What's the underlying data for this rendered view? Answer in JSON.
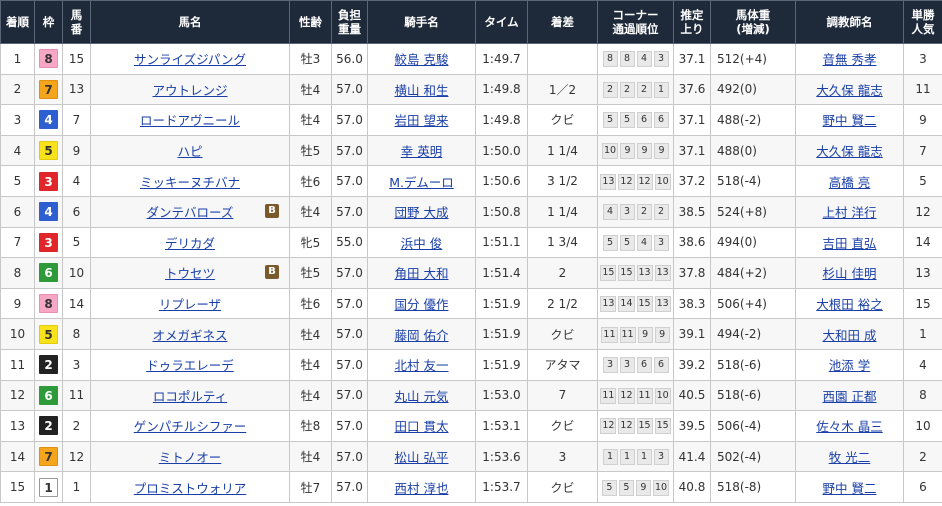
{
  "headers": {
    "rank": "着順",
    "waku": "枠",
    "umaban": [
      "馬",
      "番"
    ],
    "horse": "馬名",
    "sexage": "性齢",
    "weight": [
      "負担",
      "重量"
    ],
    "jockey": "騎手名",
    "time": "タイム",
    "margin": "着差",
    "corner": [
      "コーナー",
      "通過順位"
    ],
    "last": [
      "推定",
      "上り"
    ],
    "bodyweight": [
      "馬体重",
      "(増減)"
    ],
    "trainer": "調教師名",
    "pop": [
      "単勝",
      "人気"
    ]
  },
  "waku_colors": {
    "1": {
      "bg": "#ffffff",
      "fg": "#333333",
      "border": "#999999"
    },
    "2": {
      "bg": "#222222",
      "fg": "#ffffff",
      "border": "#222222"
    },
    "3": {
      "bg": "#e0262a",
      "fg": "#ffffff",
      "border": "#e0262a"
    },
    "4": {
      "bg": "#2e5fd1",
      "fg": "#ffffff",
      "border": "#2e5fd1"
    },
    "5": {
      "bg": "#f7e21b",
      "fg": "#333333",
      "border": "#e0cc10"
    },
    "6": {
      "bg": "#2f9a3a",
      "fg": "#ffffff",
      "border": "#2f9a3a"
    },
    "7": {
      "bg": "#f5a51c",
      "fg": "#333333",
      "border": "#e09010"
    },
    "8": {
      "bg": "#f7a6c6",
      "fg": "#333333",
      "border": "#e88fb2"
    }
  },
  "rows": [
    {
      "rank": "1",
      "waku": "8",
      "umaban": "15",
      "horse": "サンライズジパング",
      "blinker": "",
      "sexage": "牡3",
      "weight": "56.0",
      "jockey": "鮫島 克駿",
      "time": "1:49.7",
      "margin": "",
      "corners": [
        "8",
        "8",
        "4",
        "3"
      ],
      "last": "37.1",
      "bodyweight": "512(+4)",
      "trainer": "音無 秀孝",
      "pop": "3"
    },
    {
      "rank": "2",
      "waku": "7",
      "umaban": "13",
      "horse": "アウトレンジ",
      "blinker": "",
      "sexage": "牡4",
      "weight": "57.0",
      "jockey": "横山 和生",
      "time": "1:49.8",
      "margin": "1／2",
      "corners": [
        "2",
        "2",
        "2",
        "1"
      ],
      "last": "37.6",
      "bodyweight": "492(0)",
      "trainer": "大久保 龍志",
      "pop": "11"
    },
    {
      "rank": "3",
      "waku": "4",
      "umaban": "7",
      "horse": "ロードアヴニール",
      "blinker": "",
      "sexage": "牡4",
      "weight": "57.0",
      "jockey": "岩田 望来",
      "time": "1:49.8",
      "margin": "クビ",
      "corners": [
        "5",
        "5",
        "6",
        "6"
      ],
      "last": "37.1",
      "bodyweight": "488(-2)",
      "trainer": "野中 賢二",
      "pop": "9"
    },
    {
      "rank": "4",
      "waku": "5",
      "umaban": "9",
      "horse": "ハピ",
      "blinker": "",
      "sexage": "牡5",
      "weight": "57.0",
      "jockey": "幸 英明",
      "time": "1:50.0",
      "margin": "1 1/4",
      "corners": [
        "10",
        "9",
        "9",
        "9"
      ],
      "last": "37.1",
      "bodyweight": "488(0)",
      "trainer": "大久保 龍志",
      "pop": "7"
    },
    {
      "rank": "5",
      "waku": "3",
      "umaban": "4",
      "horse": "ミッキーヌチバナ",
      "blinker": "",
      "sexage": "牡6",
      "weight": "57.0",
      "jockey": "M.デムーロ",
      "time": "1:50.6",
      "margin": "3 1/2",
      "corners": [
        "13",
        "12",
        "12",
        "10"
      ],
      "last": "37.2",
      "bodyweight": "518(-4)",
      "trainer": "高橋 亮",
      "pop": "5"
    },
    {
      "rank": "6",
      "waku": "4",
      "umaban": "6",
      "horse": "ダンテバローズ",
      "blinker": "B",
      "sexage": "牡4",
      "weight": "57.0",
      "jockey": "団野 大成",
      "time": "1:50.8",
      "margin": "1 1/4",
      "corners": [
        "4",
        "3",
        "2",
        "2"
      ],
      "last": "38.5",
      "bodyweight": "524(+8)",
      "trainer": "上村 洋行",
      "pop": "12"
    },
    {
      "rank": "7",
      "waku": "3",
      "umaban": "5",
      "horse": "デリカダ",
      "blinker": "",
      "sexage": "牝5",
      "weight": "55.0",
      "jockey": "浜中 俊",
      "time": "1:51.1",
      "margin": "1 3/4",
      "corners": [
        "5",
        "5",
        "4",
        "3"
      ],
      "last": "38.6",
      "bodyweight": "494(0)",
      "trainer": "吉田 直弘",
      "pop": "14"
    },
    {
      "rank": "8",
      "waku": "6",
      "umaban": "10",
      "horse": "トウセツ",
      "blinker": "B",
      "sexage": "牡5",
      "weight": "57.0",
      "jockey": "角田 大和",
      "time": "1:51.4",
      "margin": "2",
      "corners": [
        "15",
        "15",
        "13",
        "13"
      ],
      "last": "37.8",
      "bodyweight": "484(+2)",
      "trainer": "杉山 佳明",
      "pop": "13"
    },
    {
      "rank": "9",
      "waku": "8",
      "umaban": "14",
      "horse": "リプレーザ",
      "blinker": "",
      "sexage": "牡6",
      "weight": "57.0",
      "jockey": "国分 優作",
      "time": "1:51.9",
      "margin": "2 1/2",
      "corners": [
        "13",
        "14",
        "15",
        "13"
      ],
      "last": "38.3",
      "bodyweight": "506(+4)",
      "trainer": "大根田 裕之",
      "pop": "15"
    },
    {
      "rank": "10",
      "waku": "5",
      "umaban": "8",
      "horse": "オメガギネス",
      "blinker": "",
      "sexage": "牡4",
      "weight": "57.0",
      "jockey": "藤岡 佑介",
      "time": "1:51.9",
      "margin": "クビ",
      "corners": [
        "11",
        "11",
        "9",
        "9"
      ],
      "last": "39.1",
      "bodyweight": "494(-2)",
      "trainer": "大和田 成",
      "pop": "1"
    },
    {
      "rank": "11",
      "waku": "2",
      "umaban": "3",
      "horse": "ドゥラエレーデ",
      "blinker": "",
      "sexage": "牡4",
      "weight": "57.0",
      "jockey": "北村 友一",
      "time": "1:51.9",
      "margin": "アタマ",
      "corners": [
        "3",
        "3",
        "6",
        "6"
      ],
      "last": "39.2",
      "bodyweight": "518(-6)",
      "trainer": "池添 学",
      "pop": "4"
    },
    {
      "rank": "12",
      "waku": "6",
      "umaban": "11",
      "horse": "ロコポルティ",
      "blinker": "",
      "sexage": "牡4",
      "weight": "57.0",
      "jockey": "丸山 元気",
      "time": "1:53.0",
      "margin": "7",
      "corners": [
        "11",
        "12",
        "11",
        "10"
      ],
      "last": "40.5",
      "bodyweight": "518(-6)",
      "trainer": "西園 正都",
      "pop": "8"
    },
    {
      "rank": "13",
      "waku": "2",
      "umaban": "2",
      "horse": "ゲンパチルシファー",
      "blinker": "",
      "sexage": "牡8",
      "weight": "57.0",
      "jockey": "田口 貫太",
      "time": "1:53.1",
      "margin": "クビ",
      "corners": [
        "12",
        "12",
        "15",
        "15"
      ],
      "last": "39.5",
      "bodyweight": "506(-4)",
      "trainer": "佐々木 晶三",
      "pop": "10"
    },
    {
      "rank": "14",
      "waku": "7",
      "umaban": "12",
      "horse": "ミトノオー",
      "blinker": "",
      "sexage": "牡4",
      "weight": "57.0",
      "jockey": "松山 弘平",
      "time": "1:53.6",
      "margin": "3",
      "corners": [
        "1",
        "1",
        "1",
        "3"
      ],
      "last": "41.4",
      "bodyweight": "502(-4)",
      "trainer": "牧 光二",
      "pop": "2"
    },
    {
      "rank": "15",
      "waku": "1",
      "umaban": "1",
      "horse": "プロミストウォリア",
      "blinker": "",
      "sexage": "牡7",
      "weight": "57.0",
      "jockey": "西村 淳也",
      "time": "1:53.7",
      "margin": "クビ",
      "corners": [
        "5",
        "5",
        "9",
        "10"
      ],
      "last": "40.8",
      "bodyweight": "518(-8)",
      "trainer": "野中 賢二",
      "pop": "6"
    }
  ]
}
